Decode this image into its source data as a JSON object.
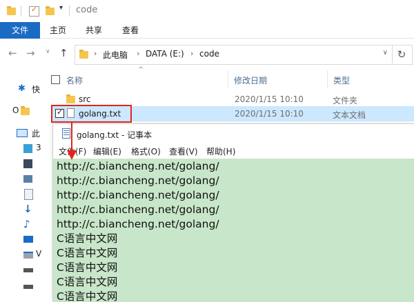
{
  "window": {
    "title": "code"
  },
  "ribbon": {
    "tabs": [
      "文件",
      "主页",
      "共享",
      "查看"
    ]
  },
  "address": {
    "crumbs": [
      "此电脑",
      "DATA (E:)",
      "code"
    ]
  },
  "left_nav": {
    "items": [
      {
        "label": "快",
        "icon": "star-icon"
      },
      {
        "label": "O",
        "icon": "folder-icon"
      },
      {
        "label": "此",
        "icon": "computer-icon"
      },
      {
        "label": "3",
        "icon": "cube-icon"
      },
      {
        "label": "",
        "icon": "film-icon"
      },
      {
        "label": "",
        "icon": "picture-icon"
      },
      {
        "label": "",
        "icon": "document-icon"
      },
      {
        "label": "",
        "icon": "download-icon"
      },
      {
        "label": "",
        "icon": "music-icon"
      },
      {
        "label": "",
        "icon": "desktop-icon"
      },
      {
        "label": "V",
        "icon": "drive-icon"
      },
      {
        "label": "",
        "icon": "drive2-icon"
      }
    ]
  },
  "columns": {
    "name": "名称",
    "date": "修改日期",
    "type": "类型"
  },
  "files": [
    {
      "name": "src",
      "date": "2020/1/15 10:10",
      "type": "文件夹",
      "icon": "folder-icon"
    },
    {
      "name": "golang.txt",
      "date": "2020/1/15 10:10",
      "type": "文本文档",
      "icon": "text-file-icon",
      "selected": true
    }
  ],
  "notepad": {
    "title": "golang.txt - 记事本",
    "menu": [
      "文件(F)",
      "编辑(E)",
      "格式(O)",
      "查看(V)",
      "帮助(H)"
    ],
    "lines": [
      "http://c.biancheng.net/golang/",
      "http://c.biancheng.net/golang/",
      "http://c.biancheng.net/golang/",
      "http://c.biancheng.net/golang/",
      "http://c.biancheng.net/golang/",
      "C语言中文网",
      "C语言中文网",
      "C语言中文网",
      "C语言中文网",
      "C语言中文网"
    ]
  },
  "colors": {
    "accent": "#1a6bc4",
    "selection": "#cce8ff",
    "highlight": "#e3231c",
    "text_bg": "#c8e6c9"
  }
}
